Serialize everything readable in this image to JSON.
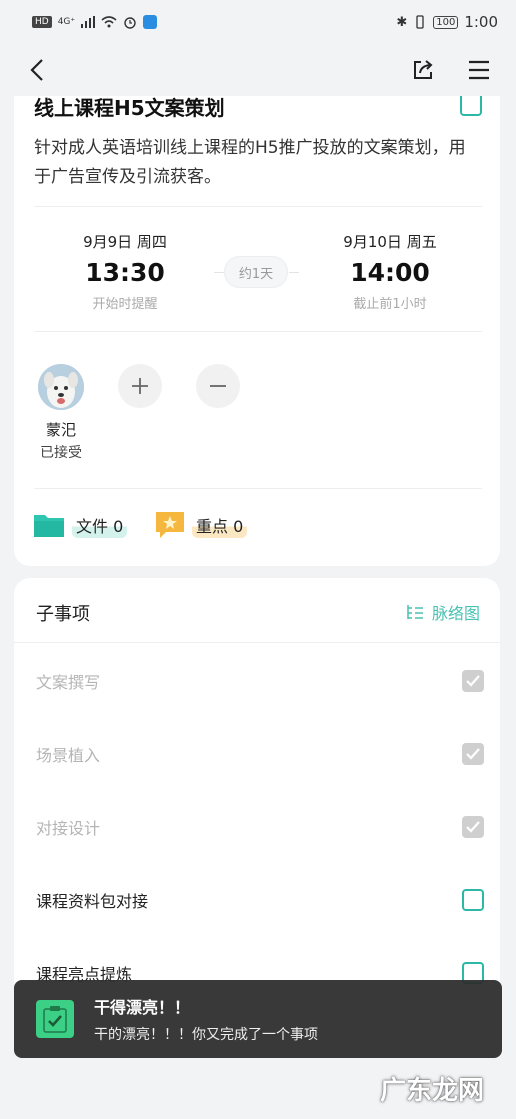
{
  "status_bar": {
    "left_badge": "HD",
    "network": "4G⁺",
    "time": "1:00",
    "battery": "100"
  },
  "task": {
    "title": "线上课程H5文案策划",
    "description": "针对成人英语培训线上课程的H5推广投放的文案策划，用于广告宣传及引流获客。",
    "start": {
      "date": "9月9日 周四",
      "time": "13:30",
      "note": "开始时提醒"
    },
    "duration": "约1天",
    "end": {
      "date": "9月10日 周五",
      "time": "14:00",
      "note": "截止前1小时"
    },
    "member": {
      "name": "蒙汜",
      "status": "已接受"
    },
    "files_label": "文件 0",
    "keypoints_label": "重点 0"
  },
  "subtasks": {
    "title": "子事项",
    "mindmap_label": "脉络图",
    "items": [
      {
        "label": "文案撰写",
        "done": true
      },
      {
        "label": "场景植入",
        "done": true
      },
      {
        "label": "对接设计",
        "done": true
      },
      {
        "label": "课程资料包对接",
        "done": false
      },
      {
        "label": "课程亮点提炼",
        "done": false
      }
    ]
  },
  "toast": {
    "title": "干得漂亮！！",
    "message": "干的漂亮！！！你又完成了一个事项"
  },
  "watermark": "广东龙网",
  "colors": {
    "accent": "#2bb8a4",
    "toast_icon": "#3ccf86"
  }
}
